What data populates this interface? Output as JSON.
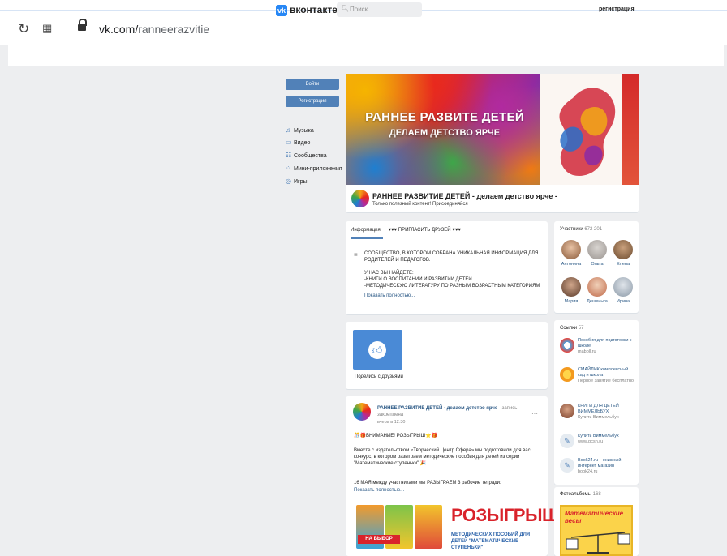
{
  "browser": {
    "reload_icon": "reload-icon",
    "apps_icon": "apps-grid-icon",
    "lock_icon": "lock-icon",
    "url_domain": "vk.com/",
    "url_path": "ranneerazvitie"
  },
  "header": {
    "logo_mark": "vk",
    "logo_text": "вконтакте",
    "search_placeholder": "Поиск",
    "register_link": "регистрация"
  },
  "sidebar": {
    "login_button": "Войти",
    "register_button": "Регистрация",
    "items": [
      {
        "label": "Музыка",
        "icon": "music-icon"
      },
      {
        "label": "Видео",
        "icon": "video-icon"
      },
      {
        "label": "Сообщества",
        "icon": "communities-icon"
      },
      {
        "label": "Мини-приложения",
        "icon": "apps-icon"
      },
      {
        "label": "Игры",
        "icon": "games-icon"
      }
    ]
  },
  "cover": {
    "title": "РАННЕЕ РАЗВИТЕ ДЕТЕЙ",
    "subtitle": "ДЕЛАЕМ ДЕТСТВО ЯРЧЕ"
  },
  "group": {
    "name": "РАННЕЕ РАЗВИТИЕ ДЕТЕЙ - делаем детство ярче -",
    "status": "Только полезный контент! Присоединяйся"
  },
  "info": {
    "tabs": [
      "Информация",
      "♥♥♥ ПРИГЛАСИТЬ ДРУЗЕЙ ♥♥♥"
    ],
    "lines": [
      "СООБЩЕСТВО, В КОТОРОМ СОБРАНА УНИКАЛЬНАЯ ИНФОРМАЦИЯ ДЛЯ",
      "РОДИТЕЛЕЙ И ПЕДАГОГОВ.",
      "",
      "У НАС ВЫ НАЙДЕТЕ:",
      "-КНИГИ О ВОСПИТАНИИ И РАЗВИТИИ ДЕТЕЙ",
      "-МЕТОДИЧЕСКУЮ ЛИТЕРАТУРУ ПО РАЗНЫМ ВОЗРАСТНЫМ КАТЕГОРИЯМ"
    ],
    "show_more": "Показать полностью..."
  },
  "members": {
    "label": "Участники",
    "count": "672 201",
    "people": [
      {
        "name": "Антонина"
      },
      {
        "name": "Ольга"
      },
      {
        "name": "Елена"
      },
      {
        "name": "Мария"
      },
      {
        "name": "Дешенька"
      },
      {
        "name": "Ирина"
      }
    ]
  },
  "share": {
    "label": "Поделись с друзьями"
  },
  "post": {
    "author": "РАННЕЕ РАЗВИТИЕ ДЕТЕЙ - делаем детство ярче",
    "author_suffix": "- запись",
    "pinned": "закреплена",
    "date": "вчера в 12:30",
    "headline": "🎊🎁ВНИМАНИЕ! РОЗЫГРЫШ⭐🎁",
    "lines": [
      "Вместе с издательством «Творческий Центр Сфера» мы подготовили для вас",
      "конкурс, в котором разыграем методические пособия для детей из серии",
      "\"Математические ступеньки\" 🎉.",
      "",
      "16 МАЯ между участниками мы РАЗЫГРАЕМ 3 рабочие тетради:"
    ],
    "show_more": "Показать полностью...",
    "image_title": "РОЗЫГРЫШ",
    "image_sub": "МЕТОДИЧЕСКИХ ПОСОБИЙ ДЛЯ ДЕТЕЙ \"МАТЕМАТИЧЕСКИЕ СТУПЕНЬКИ\"",
    "image_badge": "НА ВЫБОР"
  },
  "links": {
    "label": "Ссылки",
    "count": "57",
    "items": [
      {
        "title": "Пособия для подготовки к школе",
        "sub": "maboll.ru"
      },
      {
        "title": "СМАЙЛИК комплексный сад и школа",
        "sub": "Первое занятие бесплатно"
      },
      {
        "title": "КНИГИ ДЛЯ ДЕТЕЙ ВИММЕЛЬБУХ",
        "sub": "Купить Виммельбух"
      },
      {
        "title": "Купить Виммельбух",
        "sub": "www.pcsn.ru"
      },
      {
        "title": "Book24.ru – книжный интернет магазин",
        "sub": "book24.ru"
      }
    ]
  },
  "albums": {
    "label": "Фотоальбомы",
    "count": "168",
    "first_title": "Математические весы"
  }
}
